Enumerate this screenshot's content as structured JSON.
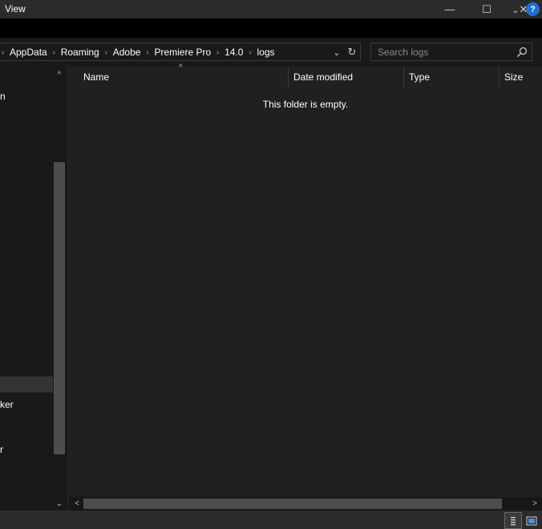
{
  "ribbon": {
    "view_tab": "View",
    "expand_glyph": "⌄",
    "help_glyph": "?"
  },
  "window": {
    "minimize_glyph": "—",
    "maximize_glyph": "☐",
    "close_glyph": "✕"
  },
  "address": {
    "separator": "›",
    "crumbs": [
      "AppData",
      "Roaming",
      "Adobe",
      "Premiere Pro",
      "14.0",
      "logs"
    ],
    "dropdown_glyph": "⌄",
    "refresh_glyph": "↻"
  },
  "search": {
    "placeholder": "Search logs",
    "value": ""
  },
  "nav_pane": {
    "partial_items": [
      "n",
      "ker",
      "r"
    ]
  },
  "columns": {
    "name": "Name",
    "date_modified": "Date modified",
    "type": "Type",
    "size": "Size",
    "sort_glyph": "^"
  },
  "content": {
    "empty_message": "This folder is empty."
  },
  "scroll": {
    "up_glyph": "^",
    "down_glyph": "⌄",
    "left_glyph": "<",
    "right_glyph": ">"
  },
  "icons": {
    "search": "search-icon",
    "details_view": "details-view-icon",
    "tiles_view": "large-icons-view-icon"
  },
  "colors": {
    "background": "#191919",
    "content_background": "#202020",
    "accent_help": "#1f6fd0"
  }
}
